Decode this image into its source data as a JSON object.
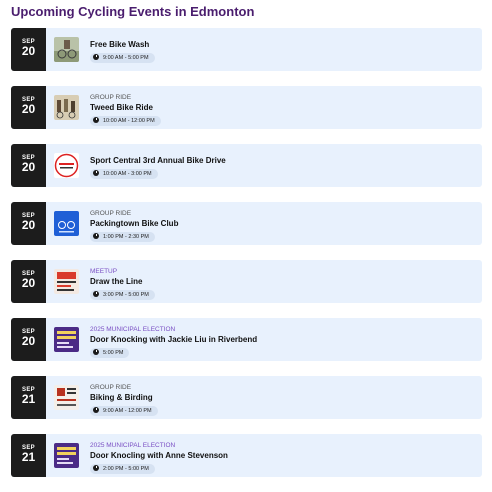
{
  "page": {
    "title": "Upcoming Cycling Events in Edmonton"
  },
  "events": [
    {
      "month": "SEP",
      "day": "20",
      "category": "",
      "title": "Free Bike Wash",
      "time": "9:00 AM - 5:00 PM",
      "thumb": "bike-wash-photo"
    },
    {
      "month": "SEP",
      "day": "20",
      "category": "GROUP RIDE",
      "title": "Tweed Bike Ride",
      "time": "10:00 AM - 12:00 PM",
      "thumb": "tweed-ride-photo"
    },
    {
      "month": "SEP",
      "day": "20",
      "category": "",
      "title": "Sport Central 3rd Annual Bike Drive",
      "time": "10:00 AM - 3:00 PM",
      "thumb": "bike-drive-logo"
    },
    {
      "month": "SEP",
      "day": "20",
      "category": "GROUP RIDE",
      "title": "Packingtown Bike Club",
      "time": "1:00 PM - 2:30 PM",
      "thumb": "bike-club-logo"
    },
    {
      "month": "SEP",
      "day": "20",
      "category": "MEETUP",
      "title": "Draw the Line",
      "time": "3:00 PM - 5:00 PM",
      "thumb": "draw-the-line-poster"
    },
    {
      "month": "SEP",
      "day": "20",
      "category": "2025 MUNICIPAL ELECTION",
      "title": "Door Knocking with Jackie Liu in Riverbend",
      "time": "5:00 PM",
      "thumb": "election-poster"
    },
    {
      "month": "SEP",
      "day": "21",
      "category": "GROUP RIDE",
      "title": "Biking & Birding",
      "time": "9:00 AM - 12:00 PM",
      "thumb": "birding-poster"
    },
    {
      "month": "SEP",
      "day": "21",
      "category": "2025 MUNICIPAL ELECTION",
      "title": "Door Knocling with Anne Stevenson",
      "time": "2:00 PM - 5:00 PM",
      "thumb": "election-poster"
    }
  ]
}
